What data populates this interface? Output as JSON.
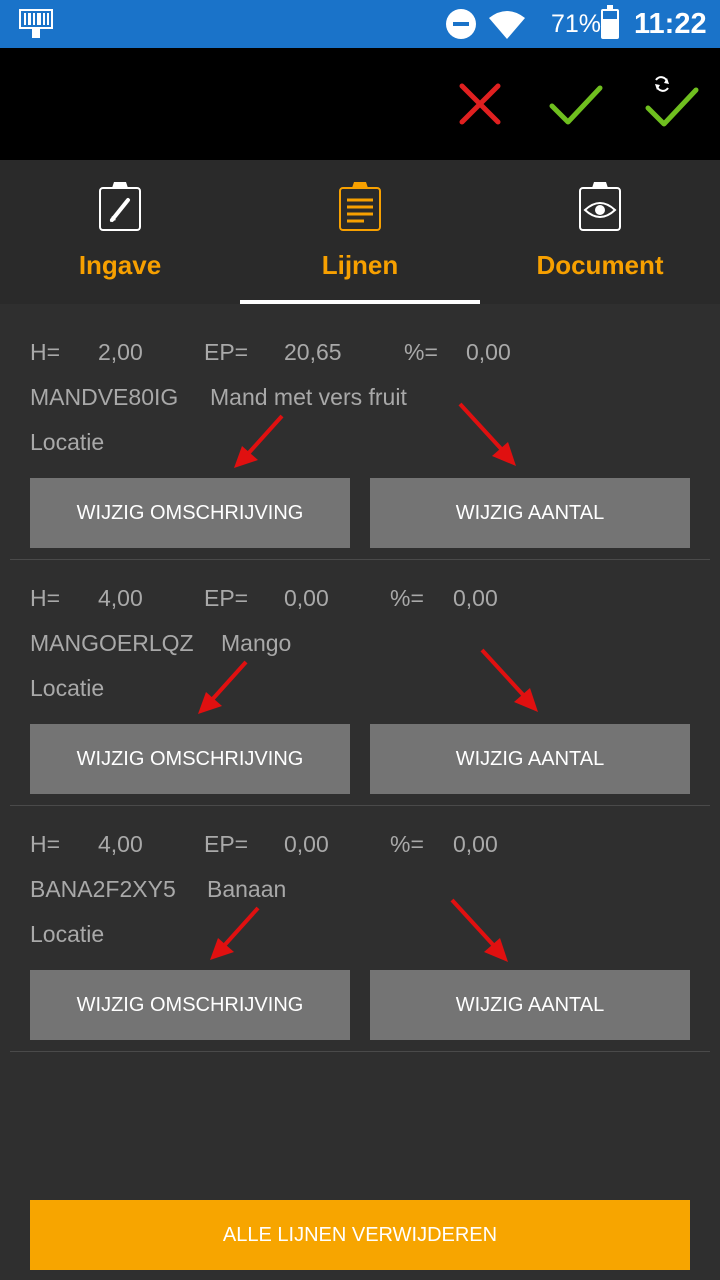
{
  "status_bar": {
    "battery_percent": "71%",
    "battery_level": 0.71,
    "time": "11:22",
    "icons": [
      "barcode-scanner-icon",
      "do-not-disturb-icon",
      "wifi-icon",
      "battery-icon"
    ],
    "background": "#1a73c9"
  },
  "toolbar": {
    "actions": [
      "cancel-icon",
      "confirm-icon",
      "confirm-sync-icon"
    ],
    "colors": {
      "cancel": "#e02020",
      "confirm": "#6fbf1f"
    }
  },
  "tabs": [
    {
      "label": "Ingave",
      "icon": "clipboard-edit-icon",
      "active": false
    },
    {
      "label": "Lijnen",
      "icon": "clipboard-list-icon",
      "active": true
    },
    {
      "label": "Document",
      "icon": "clipboard-eye-icon",
      "active": false
    }
  ],
  "labels": {
    "h": "H=",
    "ep": "EP=",
    "pct": "%=",
    "location": "Locatie",
    "edit_description": "WIJZIG OMSCHRIJVING",
    "edit_quantity": "WIJZIG AANTAL"
  },
  "lines": [
    {
      "h": "2,00",
      "ep": "20,65",
      "pct": "0,00",
      "code": "MANDVE80IG",
      "description": "Mand met vers fruit"
    },
    {
      "h": "4,00",
      "ep": "0,00",
      "pct": "0,00",
      "code": "MANGOERLQZ",
      "description": "Mango"
    },
    {
      "h": "4,00",
      "ep": "0,00",
      "pct": "0,00",
      "code": "BANA2F2XY5",
      "description": "Banaan"
    }
  ],
  "delete_all_label": "ALLE LIJNEN VERWIJDEREN",
  "accent_color": "#f7a500",
  "annotation_color": "#e01010"
}
